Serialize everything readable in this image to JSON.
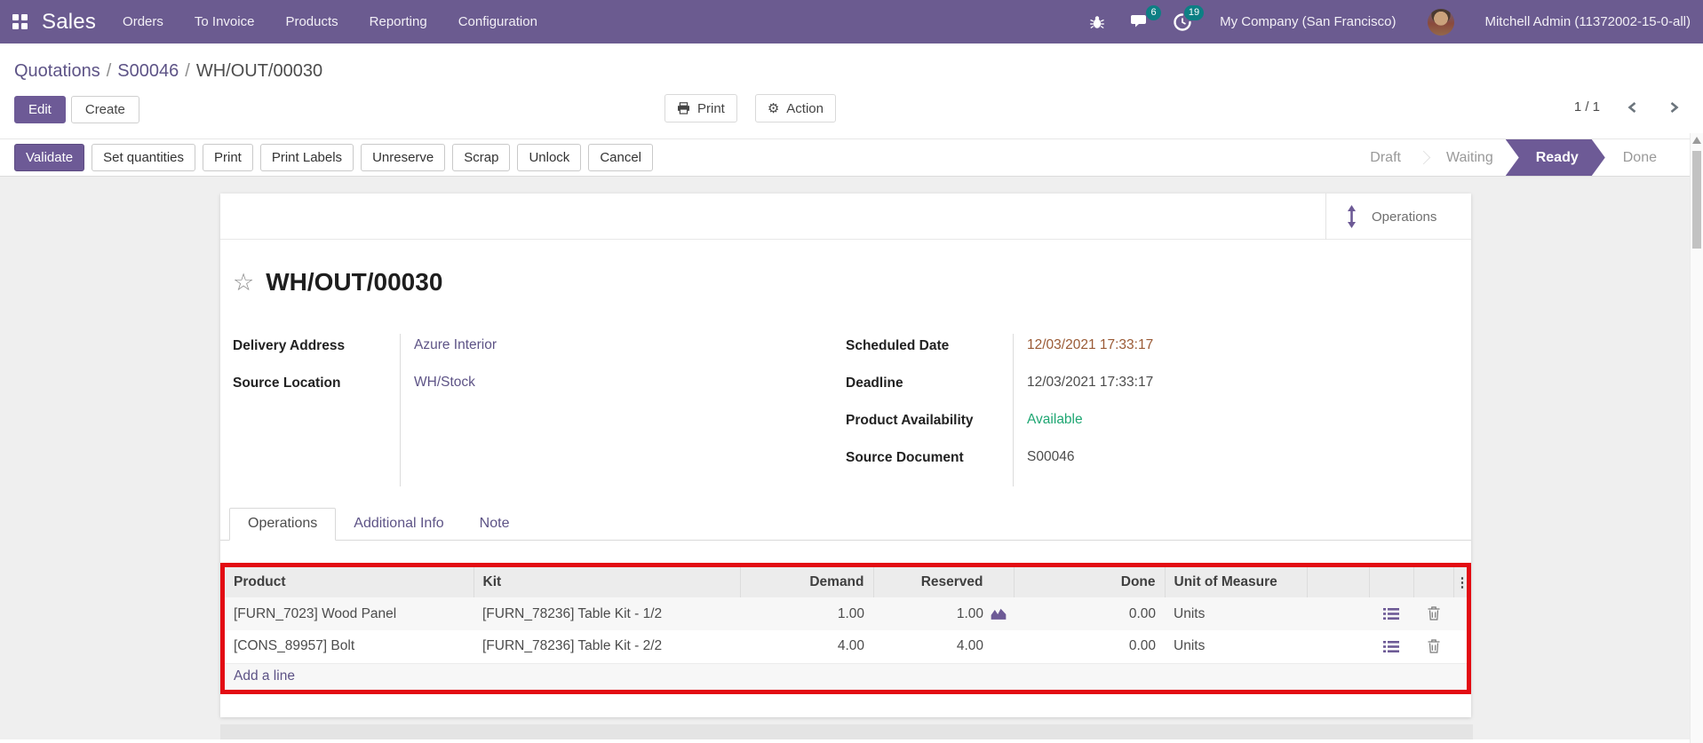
{
  "nav": {
    "brand": "Sales",
    "items": [
      "Orders",
      "To Invoice",
      "Products",
      "Reporting",
      "Configuration"
    ],
    "messages_badge": "6",
    "activities_badge": "19",
    "company": "My Company (San Francisco)",
    "user": "Mitchell Admin (11372002-15-0-all)"
  },
  "breadcrumb": {
    "part1": "Quotations",
    "part2": "S00046",
    "current": "WH/OUT/00030",
    "separator": "/"
  },
  "toolbar": {
    "edit": "Edit",
    "create": "Create",
    "print": "Print",
    "action": "Action",
    "pager": "1 / 1"
  },
  "statusbar": {
    "buttons": [
      "Validate",
      "Set quantities",
      "Print",
      "Print Labels",
      "Unreserve",
      "Scrap",
      "Unlock",
      "Cancel"
    ],
    "states": [
      "Draft",
      "Waiting",
      "Ready",
      "Done"
    ],
    "active_state": "Ready"
  },
  "form": {
    "smart_button": "Operations",
    "title": "WH/OUT/00030",
    "fields_left": [
      {
        "label": "Delivery Address",
        "value": "Azure Interior"
      },
      {
        "label": "Source Location",
        "value": "WH/Stock"
      }
    ],
    "fields_right": [
      {
        "label": "Scheduled Date",
        "value": "12/03/2021 17:33:17"
      },
      {
        "label": "Deadline",
        "value": "12/03/2021 17:33:17"
      },
      {
        "label": "Product Availability",
        "value": "Available"
      },
      {
        "label": "Source Document",
        "value": "S00046"
      }
    ],
    "tabs": [
      "Operations",
      "Additional Info",
      "Note"
    ]
  },
  "table": {
    "headers": [
      "Product",
      "Kit",
      "Demand",
      "Reserved",
      "Done",
      "Unit of Measure"
    ],
    "rows": [
      {
        "product": "[FURN_7023] Wood Panel",
        "kit": "[FURN_78236] Table Kit - 1/2",
        "demand": "1.00",
        "reserved": "1.00",
        "done": "0.00",
        "uom": "Units"
      },
      {
        "product": "[CONS_89957] Bolt",
        "kit": "[FURN_78236] Table Kit - 2/2",
        "demand": "4.00",
        "reserved": "4.00",
        "done": "0.00",
        "uom": "Units"
      }
    ],
    "add_line": "Add a line"
  },
  "icons": {
    "star": "☆",
    "gear": "⚙",
    "kebab": "⋮"
  },
  "colors": {
    "nav_purple": "#6b5b90",
    "accent_purple": "#6d5a96",
    "link_purple": "#5d5386",
    "badge_teal": "#0d7f84",
    "date_text": "#9a5a35",
    "success_green": "#1ea672",
    "highlight_red": "#e30b13"
  }
}
